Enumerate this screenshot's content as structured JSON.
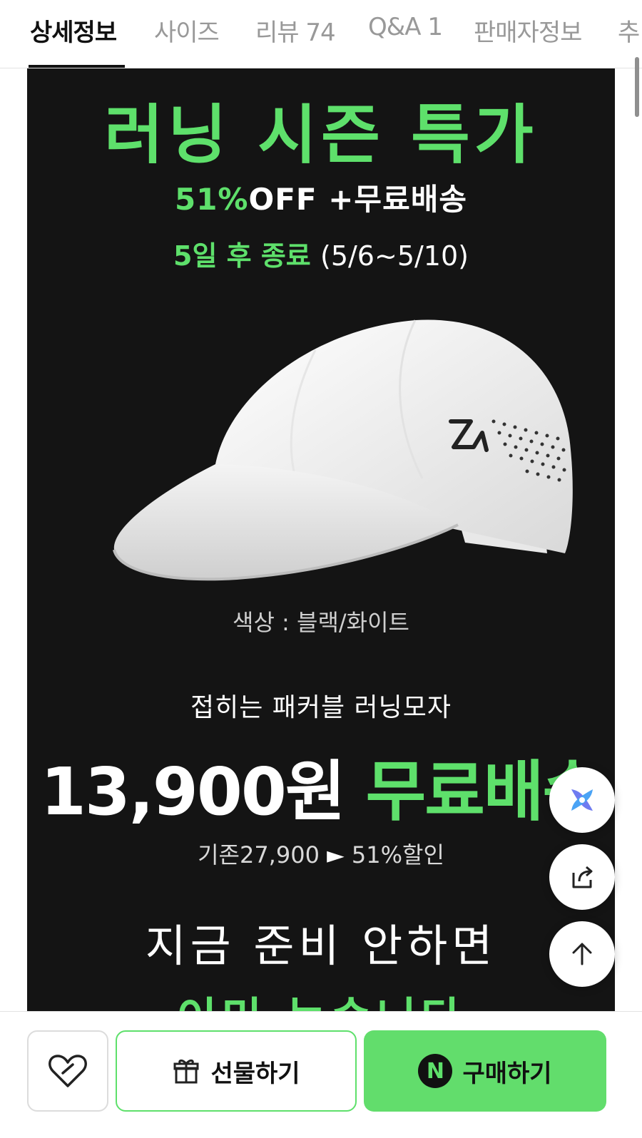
{
  "tabs": [
    {
      "label": "상세정보",
      "active": true
    },
    {
      "label": "사이즈",
      "active": false
    },
    {
      "label": "리뷰 74",
      "active": false
    },
    {
      "label": "Q&A 1",
      "active": false
    },
    {
      "label": "판매자정보",
      "active": false
    },
    {
      "label": "추",
      "active": false
    }
  ],
  "promo": {
    "headline": "러닝 시즌 특가",
    "discount": "51%",
    "off_text": "OFF",
    "free_ship": "+무료배송",
    "ends_in": "5일 후 종료",
    "dates": "(5/6~5/10)"
  },
  "product": {
    "color_label": "색상 : 블랙/화이트",
    "name": "접히는 패커블 러닝모자",
    "price": "13,900원",
    "price_tag": "무료배송",
    "original": "기존27,900",
    "arrow": "►",
    "discount_text": "51%할인",
    "slogan_line1": "지금 준비 안하면",
    "slogan_line2": "이미 늦습니다"
  },
  "bottom": {
    "gift_label": "선물하기",
    "buy_label": "구매하기",
    "naver_badge": "N"
  },
  "colors": {
    "accent_green": "#5ee06b",
    "panel_bg": "#141414"
  },
  "icons": [
    "ai-assistant-icon",
    "share-icon",
    "arrow-up-icon",
    "heart-icon",
    "gift-icon",
    "naver-n-icon"
  ]
}
